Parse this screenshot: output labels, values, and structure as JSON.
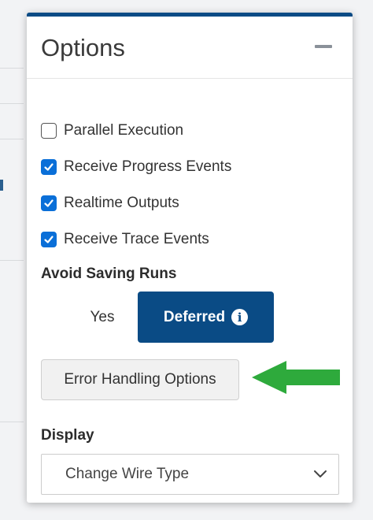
{
  "panel": {
    "title": "Options",
    "collapse_icon": "minus-icon"
  },
  "checkboxes": [
    {
      "label": "Parallel Execution",
      "checked": false
    },
    {
      "label": "Receive Progress Events",
      "checked": true
    },
    {
      "label": "Realtime Outputs",
      "checked": true
    },
    {
      "label": "Receive Trace Events",
      "checked": true
    }
  ],
  "avoid_saving_runs": {
    "label": "Avoid Saving Runs",
    "options": [
      "Yes",
      "Deferred"
    ],
    "selected": "Deferred",
    "info_icon": "info-circle-icon"
  },
  "error_handling": {
    "button_label": "Error Handling Options"
  },
  "display": {
    "label": "Display",
    "select_value": "Change Wire Type"
  },
  "colors": {
    "accent": "#0a4b85",
    "checkbox": "#0a6fd8",
    "annotation_arrow": "#2eaa3c"
  }
}
